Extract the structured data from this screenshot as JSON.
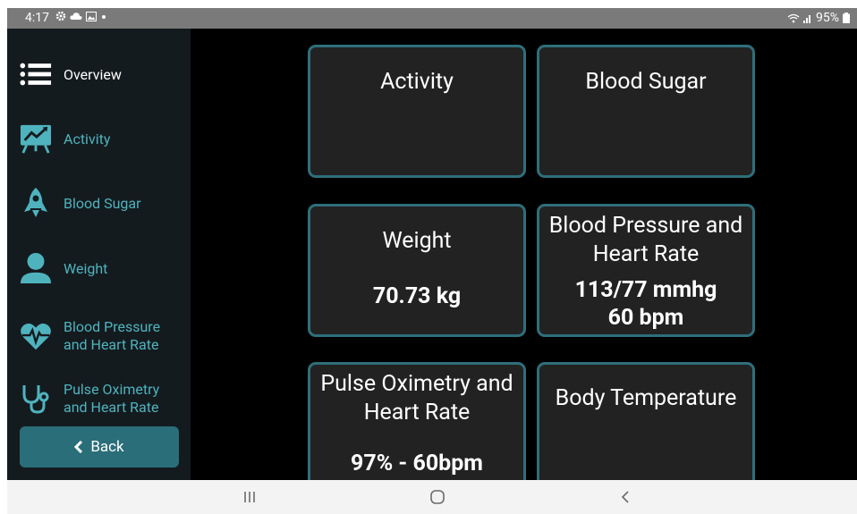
{
  "status_bar": {
    "time": "4:17",
    "battery_percent": "95%",
    "left_icons": [
      "settings-icon",
      "cloud-icon",
      "image-icon",
      "dot-icon"
    ],
    "right_icons": [
      "wifi-icon",
      "signal-icon",
      "battery-icon"
    ]
  },
  "sidebar": {
    "items": [
      {
        "label": "Overview",
        "icon": "list-icon",
        "active": true
      },
      {
        "label": "Activity",
        "icon": "chart-board-icon",
        "active": false
      },
      {
        "label": "Blood Sugar",
        "icon": "rocket-icon",
        "active": false
      },
      {
        "label": "Weight",
        "icon": "person-icon",
        "active": false
      },
      {
        "label": "Blood Pressure\nand Heart Rate",
        "icon": "heart-pulse-icon",
        "active": false
      },
      {
        "label": "Pulse Oximetry\nand Heart Rate",
        "icon": "stethoscope-icon",
        "active": false
      }
    ],
    "back_label": "Back"
  },
  "cards": [
    {
      "title": "Activity",
      "value": ""
    },
    {
      "title": "Blood Sugar",
      "value": ""
    },
    {
      "title": "Weight",
      "value": "70.73 kg"
    },
    {
      "title": "Blood Pressure and Heart Rate",
      "value": "113/77 mmhg\n60 bpm"
    },
    {
      "title": "Pulse Oximetry and Heart Rate",
      "value": "97% - 60bpm"
    },
    {
      "title": "Body Temperature",
      "value": ""
    }
  ],
  "colors": {
    "accent": "#4fb3be",
    "card_border": "#2e6f7b",
    "back_button": "#2a6e7a",
    "sidebar_bg": "#141b1f",
    "card_bg": "#222222"
  },
  "nav_bar": {
    "icons": [
      "recents-icon",
      "home-icon",
      "back-nav-icon"
    ]
  }
}
